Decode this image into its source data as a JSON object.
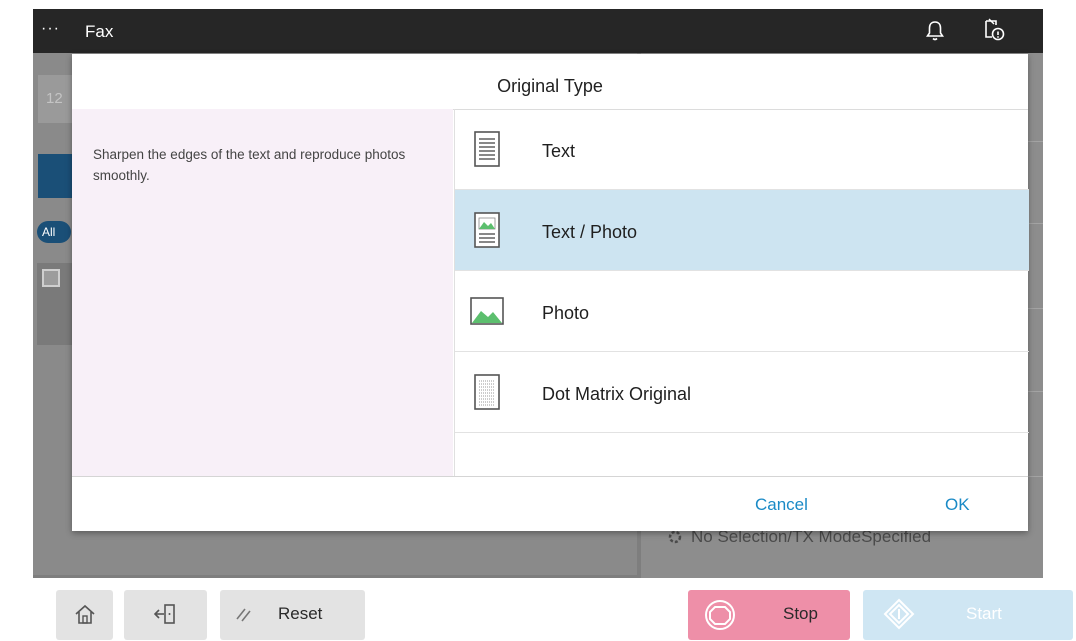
{
  "topbar": {
    "menu_label": "···",
    "title": "Fax"
  },
  "background": {
    "number_field_value": "12",
    "filter_pill": "All",
    "status_text": "No Selection/TX ModeSpecified"
  },
  "modal": {
    "title": "Original Type",
    "description": "Sharpen the edges of the text and reproduce photos smoothly.",
    "options": [
      {
        "label": "Text",
        "icon": "text-document-icon",
        "selected": false
      },
      {
        "label": "Text / Photo",
        "icon": "text-photo-document-icon",
        "selected": true
      },
      {
        "label": "Photo",
        "icon": "photo-icon",
        "selected": false
      },
      {
        "label": "Dot Matrix Original",
        "icon": "dot-matrix-document-icon",
        "selected": false
      }
    ],
    "cancel_label": "Cancel",
    "ok_label": "OK"
  },
  "bottombar": {
    "reset_label": "Reset",
    "stop_label": "Stop",
    "start_label": "Start"
  },
  "colors": {
    "accent": "#1a8ac6",
    "selected_row": "#cde4f1",
    "stop": "#ee8fa8",
    "start": "#cfe6f3",
    "description_panel": "#f8f0f8"
  }
}
